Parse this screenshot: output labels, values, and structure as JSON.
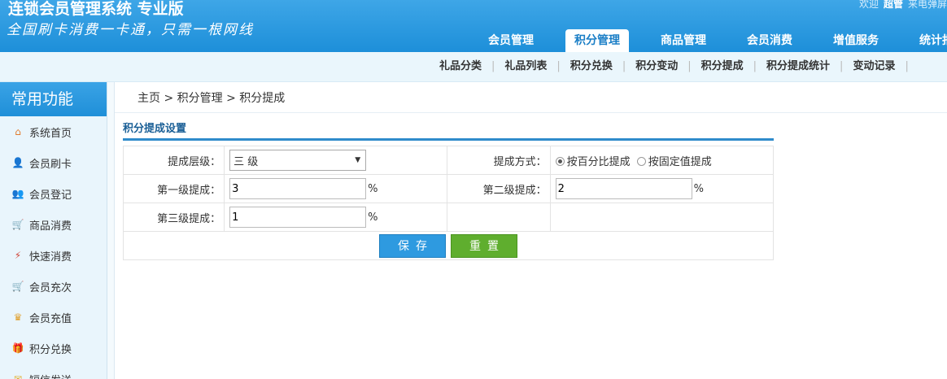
{
  "header": {
    "app_title": "连锁会员管理系统 专业版",
    "slogan": "全国刷卡消费一卡通，只需一根网线",
    "welcome": "欢迎",
    "username": "超管",
    "extra": "来电弹屏"
  },
  "main_nav": [
    "会员管理",
    "积分管理",
    "商品管理",
    "会员消费",
    "增值服务",
    "统计报表"
  ],
  "sub_nav": [
    "礼品分类",
    "礼品列表",
    "积分兑换",
    "积分变动",
    "积分提成",
    "积分提成统计",
    "变动记录"
  ],
  "sidebar": {
    "title": "常用功能",
    "items": [
      {
        "label": "系统首页",
        "icon": "home-icon",
        "color": "#e07a2e",
        "glyph": "⌂"
      },
      {
        "label": "会员刷卡",
        "icon": "user-card-icon",
        "color": "#3a7fc7",
        "glyph": "👤"
      },
      {
        "label": "会员登记",
        "icon": "users-icon",
        "color": "#3a7fc7",
        "glyph": "👥"
      },
      {
        "label": "商品消费",
        "icon": "cart-icon",
        "color": "#d9822b",
        "glyph": "🛒"
      },
      {
        "label": "快速消费",
        "icon": "fast-icon",
        "color": "#d0473a",
        "glyph": "⚡"
      },
      {
        "label": "会员充次",
        "icon": "recharge-count-icon",
        "color": "#3a7fc7",
        "glyph": "🛒"
      },
      {
        "label": "会员充值",
        "icon": "crown-icon",
        "color": "#e0a02e",
        "glyph": "♛"
      },
      {
        "label": "积分兑换",
        "icon": "gift-icon",
        "color": "#2e9ae0",
        "glyph": "🎁"
      },
      {
        "label": "短信发送",
        "icon": "mail-icon",
        "color": "#e0b02e",
        "glyph": "✉"
      }
    ]
  },
  "breadcrumb": "主页 > 积分管理 > 积分提成",
  "panel_title": "积分提成设置",
  "form": {
    "level_label": "提成层级：",
    "level_value": "三 级",
    "method_label": "提成方式：",
    "method_option1": "按百分比提成",
    "method_option2": "按固定值提成",
    "first_label": "第一级提成：",
    "first_value": "3",
    "second_label": "第二级提成：",
    "second_value": "2",
    "third_label": "第三级提成：",
    "third_value": "1",
    "percent": "%",
    "save_label": "保存",
    "reset_label": "重置"
  }
}
